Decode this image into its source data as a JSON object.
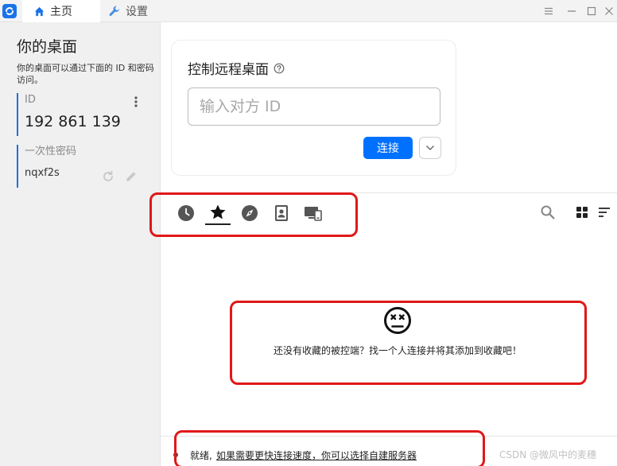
{
  "tabs": {
    "home": "主页",
    "settings": "设置"
  },
  "sidebar": {
    "title": "你的桌面",
    "description": "你的桌面可以通过下面的 ID 和密码访问。",
    "id_label": "ID",
    "id_value": "192 861 139",
    "password_label": "一次性密码",
    "password_value": "nqxf2s"
  },
  "connect": {
    "title": "控制远程桌面",
    "input_placeholder": "输入对方 ID",
    "button_label": "连接"
  },
  "peers": {
    "tabs": [
      "recent",
      "favorites",
      "discovered",
      "address-book",
      "group"
    ],
    "active_tab": "favorites",
    "empty_message": "还没有收藏的被控端？找一个人连接并将其添加到收藏吧！"
  },
  "status": {
    "ready": "就绪,",
    "link": "如果需要更快连接速度，你可以选择自建服务器"
  },
  "watermark": "CSDN @微风中的麦穗",
  "colors": {
    "accent": "#0071ff",
    "highlight": "#e01818",
    "id_bar": "#1f6fde"
  }
}
